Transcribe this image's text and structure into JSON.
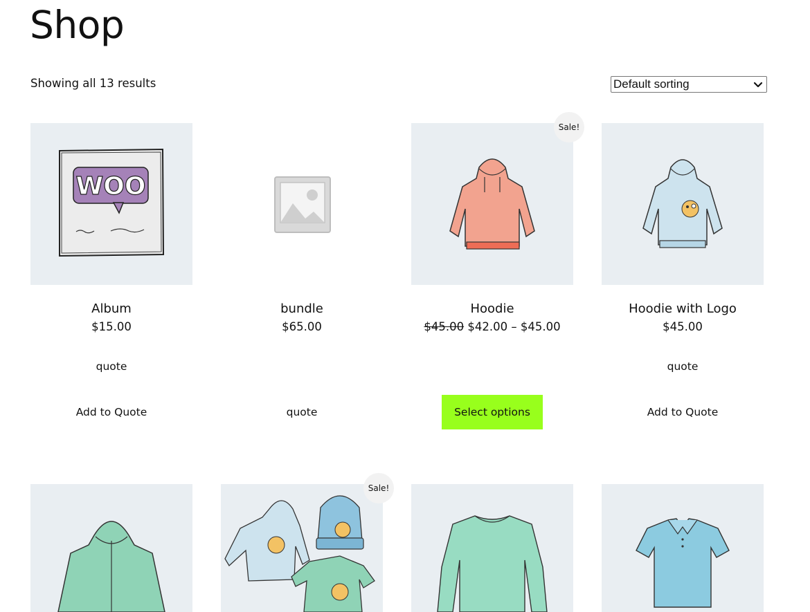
{
  "page": {
    "title": "Shop",
    "result_count": "Showing all 13 results",
    "sorting": {
      "selected": "Default sorting"
    }
  },
  "products": [
    {
      "name": "Album",
      "price": "$15.00",
      "quote_label": "quote",
      "button": "Add to Quote"
    },
    {
      "name": "bundle",
      "price": "$65.00",
      "button": "quote"
    },
    {
      "name": "Hoodie",
      "badge": "Sale!",
      "price_regular": "$45.00",
      "price_range": "$42.00 – $45.00",
      "button": "Select options"
    },
    {
      "name": "Hoodie with Logo",
      "price": "$45.00",
      "quote_label": "quote",
      "button": "Add to Quote"
    }
  ],
  "second_row": [
    {
      "image": "zip-hoodie"
    },
    {
      "image": "logo-collection",
      "badge": "Sale!"
    },
    {
      "image": "long-sleeve-tee"
    },
    {
      "image": "polo"
    }
  ],
  "colors": {
    "button_accent": "#98ff1c",
    "thumb_bg": "#e9eef2",
    "sale_badge_bg": "#f2f2f2"
  }
}
